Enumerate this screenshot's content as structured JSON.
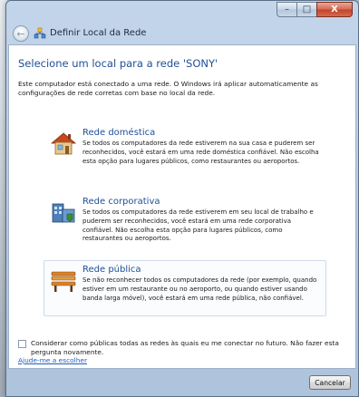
{
  "window": {
    "title": "Definir Local da Rede",
    "caption": {
      "minimize": "–",
      "maximize": "□",
      "close": "X"
    }
  },
  "main": {
    "heading": "Selecione um local para a rede 'SONY'",
    "intro": "Este computador está conectado a uma rede. O Windows irá aplicar automaticamente as configurações de rede corretas com base no local da rede.",
    "options": [
      {
        "icon": "home-icon",
        "title": "Rede doméstica",
        "description": "Se todos os computadores da rede estiverem na sua casa e puderem ser reconhecidos, você estará em uma rede doméstica confiável. Não escolha esta opção para lugares públicos, como restaurantes ou aeroportos."
      },
      {
        "icon": "work-network-icon",
        "title": "Rede corporativa",
        "description": "Se todos os computadores da rede estiverem em seu local de trabalho e puderem ser reconhecidos, você estará em uma rede corporativa confiável. Não escolha esta opção para lugares públicos, como restaurantes ou aeroportos."
      },
      {
        "icon": "bench-icon",
        "title": "Rede pública",
        "description": "Se não reconhecer todos os computadores da rede (por exemplo, quando estiver em um restaurante ou no aeroporto, ou quando estiver usando banda larga móvel), você estará em uma rede pública, não confiável."
      }
    ],
    "checkbox_label": "Considerar como públicas todas as redes às quais eu me conectar no futuro. Não fazer esta pergunta novamente.",
    "checkbox_checked": false,
    "help_link": "Ajude-me a escolher"
  },
  "footer": {
    "cancel_label": "Cancelar"
  },
  "colors": {
    "heading": "#1f4f97",
    "link": "#1f5fbf",
    "close": "#c2452c"
  }
}
